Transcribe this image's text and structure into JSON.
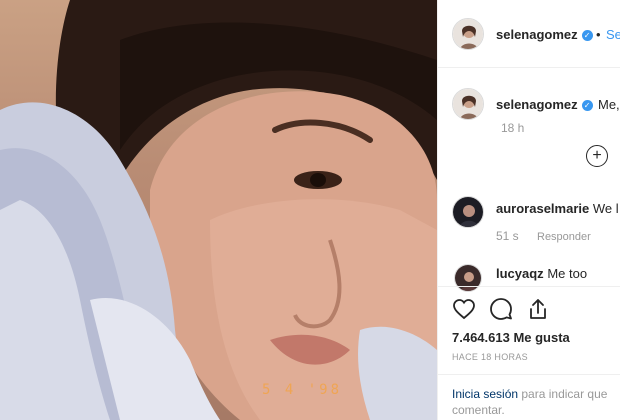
{
  "post": {
    "date_stamp": "5 4 '98"
  },
  "header": {
    "username": "selenagomez",
    "separator": "•",
    "follow_label": "Se"
  },
  "caption": {
    "username": "selenagomez",
    "text": "Me,",
    "time": "18 h"
  },
  "comments": [
    {
      "username": "auroraselmarie",
      "text": "We l",
      "time": "51 s",
      "reply_label": "Responder"
    },
    {
      "username": "lucyaqz",
      "text": "Me too"
    }
  ],
  "actions": {
    "like_icon": "heart-icon",
    "comment_icon": "comment-icon",
    "share_icon": "share-icon"
  },
  "stats": {
    "likes": "7.464.613 Me gusta",
    "posted_ago": "HACE 18 HORAS"
  },
  "login": {
    "link_label": "Inicia sesión",
    "prompt": " para indicar que",
    "prompt_line2": "comentar."
  },
  "colors": {
    "link_blue": "#3897f0",
    "text": "#262626",
    "muted": "#999999",
    "date_stamp": "#f2a449"
  }
}
